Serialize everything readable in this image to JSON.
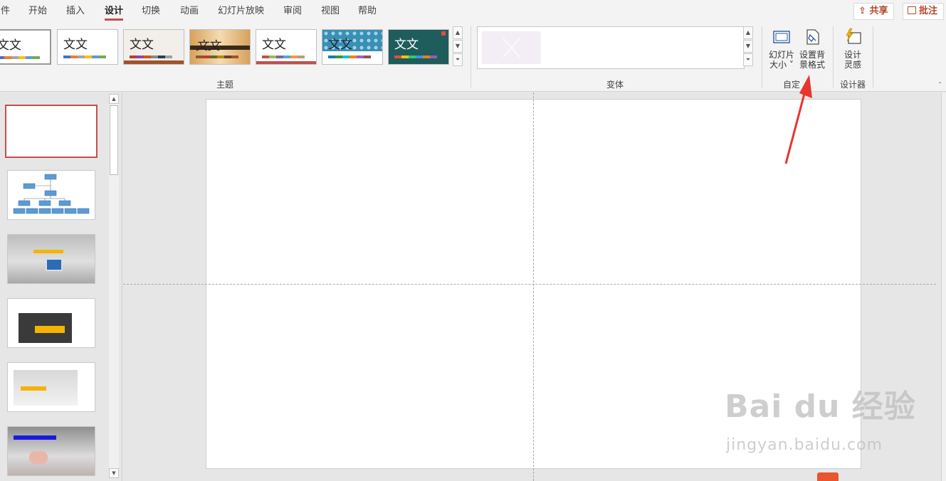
{
  "tabs": [
    "件",
    "开始",
    "插入",
    "设计",
    "切换",
    "动画",
    "幻灯片放映",
    "审阅",
    "视图",
    "帮助"
  ],
  "active_tab": "设计",
  "top_buttons": {
    "share": "共享",
    "comment": "批注"
  },
  "themes": [
    {
      "label": "文文",
      "bg": "#ffffff",
      "colors": [
        "#4472c4",
        "#ed7d31",
        "#a5a5a5",
        "#ffc000",
        "#5b9bd5",
        "#70ad47"
      ]
    },
    {
      "label": "文文",
      "bg": "#ffffff",
      "colors": [
        "#4472c4",
        "#ed7d31",
        "#a5a5a5",
        "#ffc000",
        "#5b9bd5",
        "#70ad47"
      ]
    },
    {
      "label": "文文",
      "bg": "#f2efea",
      "colors": [
        "#c0392b",
        "#8e44ad",
        "#d35400",
        "#7f8c8d",
        "#2c3e50",
        "#95a5a6"
      ]
    },
    {
      "label": "文文",
      "bg": "#e9c994",
      "colors": [
        "#8b5a2b",
        "#c0392b",
        "#556b2f",
        "#b8860b",
        "#6b4226",
        "#a0522d"
      ]
    },
    {
      "label": "文文",
      "bg": "#ffffff",
      "colors": [
        "#c0504d",
        "#9bbb59",
        "#8064a2",
        "#4bacc6",
        "#f79646",
        "#b3a36d"
      ]
    },
    {
      "label": "文文",
      "bg": "#3a8fb5",
      "colors": [
        "#1f77b4",
        "#2ca02c",
        "#17becf",
        "#ff7f0e",
        "#9467bd",
        "#8c564b"
      ]
    },
    {
      "label": "文文",
      "bg": "#1f5c5c",
      "colors": [
        "#e74c3c",
        "#f1c40f",
        "#2ecc71",
        "#3498db",
        "#e67e22",
        "#9b59b6"
      ]
    }
  ],
  "groups": {
    "themes": "主题",
    "variants": "变体",
    "customize": "自定",
    "designer": "设计器"
  },
  "buttons": {
    "slide_size_line1": "幻灯片",
    "slide_size_line2": "大小 ˅",
    "format_bg_line1": "设置背",
    "format_bg_line2": "景格式",
    "design_ideas_line1": "设计",
    "design_ideas_line2": "灵感"
  },
  "colors": {
    "accent": "#c0504d",
    "arrow": "#e8352e"
  },
  "watermark": {
    "brand": "Bai du 经验",
    "url": "jingyan.baidu.com"
  }
}
